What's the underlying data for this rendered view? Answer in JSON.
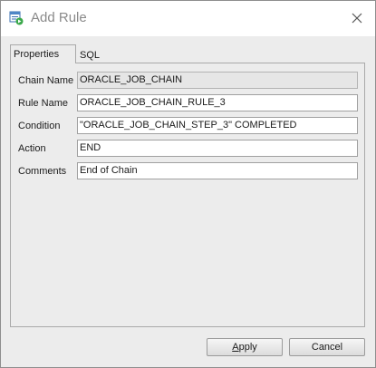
{
  "window": {
    "title": "Add Rule",
    "icon": "rule-add-icon",
    "close_icon": "close-icon"
  },
  "tabs": [
    {
      "label": "Properties",
      "selected": true
    },
    {
      "label": "SQL",
      "selected": false
    }
  ],
  "form": {
    "chain_name": {
      "label": "Chain Name",
      "value": "ORACLE_JOB_CHAIN",
      "readonly": true
    },
    "rule_name": {
      "label": "Rule Name",
      "value": "ORACLE_JOB_CHAIN_RULE_3"
    },
    "condition": {
      "label": "Condition",
      "value": "\"ORACLE_JOB_CHAIN_STEP_3\" COMPLETED"
    },
    "action": {
      "label": "Action",
      "value": "END"
    },
    "comments": {
      "label": "Comments",
      "value": "End of Chain"
    }
  },
  "buttons": {
    "apply": "Apply",
    "cancel": "Cancel"
  }
}
